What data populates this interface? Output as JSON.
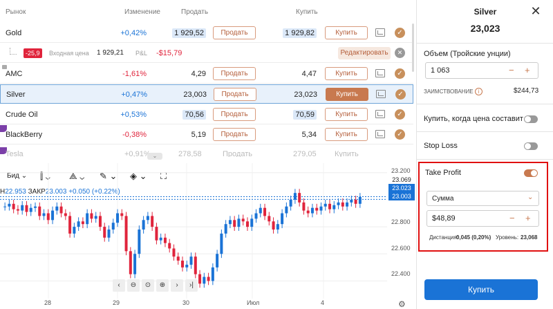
{
  "table": {
    "headers": {
      "market": "Рынок",
      "change": "Изменение",
      "sell": "Продать",
      "buy": "Купить"
    },
    "rows": [
      {
        "name": "Gold",
        "change": "+0,42%",
        "sell": "1 929,52",
        "sell_btn": "Продать",
        "buy": "1 929,82",
        "buy_btn": "Купить"
      },
      {
        "name": "AMC",
        "change": "-1,61%",
        "sell": "4,29",
        "sell_btn": "Продать",
        "buy": "4,47",
        "buy_btn": "Купить"
      },
      {
        "name": "Silver",
        "change": "+0,47%",
        "sell": "23,003",
        "sell_btn": "Продать",
        "buy": "23,023",
        "buy_btn": "Купить"
      },
      {
        "name": "Crude Oil",
        "change": "+0,53%",
        "sell": "70,56",
        "sell_btn": "Продать",
        "buy": "70,59",
        "buy_btn": "Купить"
      },
      {
        "name": "BlackBerry",
        "change": "-0,38%",
        "sell": "5,19",
        "sell_btn": "Продать",
        "buy": "5,34",
        "buy_btn": "Купить"
      }
    ],
    "partial_row": {
      "name": "Tesla",
      "change": "+0,91%",
      "sell": "278,58",
      "sell_btn": "Продать",
      "buy": "279,05",
      "buy_btn": "Купить"
    },
    "position": {
      "loss": "-25,9",
      "entry_label": "Входная цена",
      "entry": "1 929,21",
      "pnl_label": "P&L",
      "pnl": "-$15,79",
      "edit_btn": "Редактировать"
    }
  },
  "chart": {
    "toolbar": {
      "bid_label": "Бид"
    },
    "info": {
      "h_label": "Н",
      "h_value": "22.953",
      "close_label": "ЗАКР",
      "close_value": "23.003",
      "change": "+0.050 (+0.22%)"
    },
    "y_labels": [
      "23.200",
      "22.800",
      "22.600",
      "22.400"
    ],
    "y_tags": [
      "23.069",
      "23.023",
      "23.003"
    ],
    "x_labels": [
      "28",
      "29",
      "30",
      "Июл",
      "4"
    ]
  },
  "chart_data": {
    "type": "candlestick",
    "ylim": [
      22.3,
      23.25
    ],
    "close_series": [
      22.95,
      22.97,
      22.93,
      22.92,
      22.96,
      22.91,
      22.94,
      22.95,
      22.88,
      22.9,
      22.85,
      22.92,
      22.95,
      22.9,
      22.88,
      22.75,
      22.8,
      22.84,
      22.82,
      22.9,
      22.86,
      22.88,
      22.8,
      22.72,
      22.78,
      22.83,
      22.9,
      22.88,
      22.62,
      22.45,
      22.6,
      22.78,
      22.85,
      22.88,
      22.8,
      22.7,
      22.72,
      22.68,
      22.64,
      22.58,
      22.55,
      22.5,
      22.52,
      22.58,
      22.45,
      22.38,
      22.43,
      22.4,
      22.5,
      22.6,
      22.75,
      22.82,
      22.85,
      22.8,
      22.86,
      22.84,
      22.8,
      22.86,
      22.9,
      22.94,
      22.88,
      22.84,
      22.78,
      22.82,
      22.9,
      22.95,
      23.0,
      23.05,
      22.98,
      22.92,
      22.9,
      22.94,
      22.92,
      22.95,
      22.97,
      22.93,
      22.96,
      22.98,
      22.95,
      22.98,
      23.0,
      22.97,
      23.02
    ],
    "series": [
      {
        "name": "Silver",
        "values": []
      }
    ]
  },
  "panel": {
    "title": "Silver",
    "price": "23,023",
    "volume_label": "Объем (Тройские унции)",
    "volume": "1 063",
    "margin_label": "ЗАИМСТВОВАНИЕ",
    "margin_value": "$244,73",
    "buy_when_label": "Купить, когда цена составит",
    "stop_loss_label": "Stop Loss",
    "take_profit_label": "Take Profit",
    "tp_mode": "Сумма",
    "tp_value": "$48,89",
    "distance_label": "Дистанция:",
    "distance_value": "0,045 (0,20%)",
    "level_label": "Уровень:",
    "level_value": "23,068",
    "buy_button": "Купить"
  },
  "colors": {
    "accent": "#c8794f",
    "primary": "#1a73d6",
    "up": "#1a73d6",
    "down": "#e0243c",
    "highlight": "#e01010"
  }
}
